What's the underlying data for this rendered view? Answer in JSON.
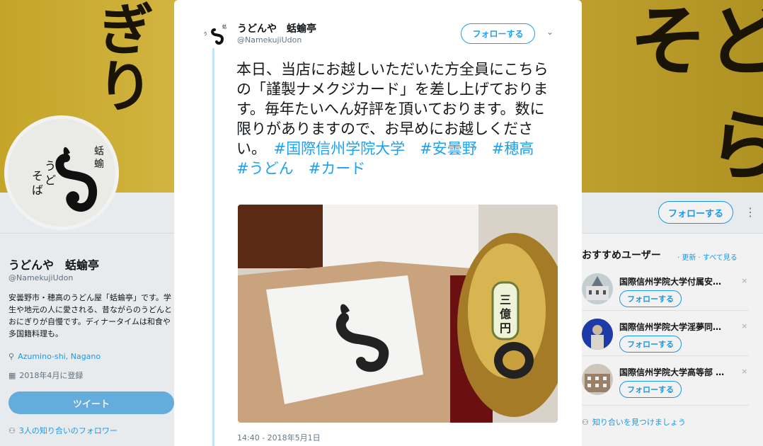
{
  "banner": {
    "text_left": "ぎり",
    "text_right": "らうど\nらそ"
  },
  "profile": {
    "name": "うどんや　蛞蝓亭",
    "handle": "@NamekujiUdon",
    "bio": "安曇野市・穂高のうどん屋「蛞蝓亭」です。学生や地元の人に愛される、昔ながらのうどんとおにぎりが自慢です。ディナータイムは和食や多国籍料理も。",
    "location": "Azumino-shi, Nagano",
    "joined": "2018年4月に登録",
    "tweet_button": "ツイート",
    "friends_following": "3人の知り合いのフォロワー"
  },
  "header": {
    "follow_button": "フォローする"
  },
  "recommendations": {
    "title": "おすすめユーザー",
    "links": "· 更新 · すべて見る",
    "items": [
      {
        "name": "国際信州学院大学付属安…",
        "follow": "フォローする"
      },
      {
        "name": "国際信州学院大学淫夢同…",
        "follow": "フォローする"
      },
      {
        "name": "国際信州学院大学高等部 …",
        "follow": "フォローする"
      }
    ],
    "close_glyph": "×",
    "find_friends": "知り合いを見つけましょう"
  },
  "tweet": {
    "name": "うどんや　蛞蝓亭",
    "handle": "@NamekujiUdon",
    "follow_button": "フォローする",
    "text": "本日、当店にお越しいただいた方全員にこちらの「謹製ナメクジカード」を差し上げております。毎年たいへん好評を頂いております。数に限りがありますので、お早めにお越しください。",
    "hashtags": [
      "#国際信州学院大学",
      "#安曇野",
      "#穂高",
      "#うどん",
      "#カード"
    ],
    "photo_label": "三億円",
    "timestamp": "14:40 - 2018年5月1日"
  },
  "colors": {
    "accent": "#1da1f2",
    "text": "#14171a",
    "muted": "#657786"
  }
}
